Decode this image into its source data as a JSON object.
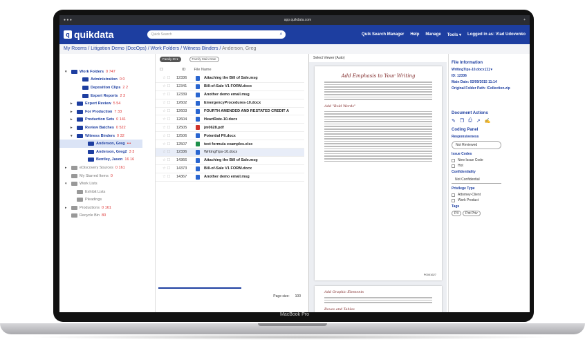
{
  "device": {
    "label": "MacBook Pro"
  },
  "browser": {
    "url": "app.quikdata.com"
  },
  "app": {
    "logo": "quikdata",
    "search_placeholder": "Quick Search",
    "nav": [
      "Quik Search Manager",
      "Help",
      "Manage",
      "Tools ▾",
      "Logged in as: Vlad Udovenko"
    ]
  },
  "breadcrumb": {
    "links": "My Rooms / Litigation Demo (DocOps) / Work Folders / Witness Binders /",
    "current": " Anderson, Greg"
  },
  "tree": [
    {
      "label": "Work Folders",
      "count": "0  747",
      "indent": 0,
      "caret": "▾"
    },
    {
      "label": "Administration",
      "count": "0  0",
      "indent": 2,
      "caret": ""
    },
    {
      "label": "Deposition Clips",
      "count": "2  2",
      "indent": 2,
      "caret": ""
    },
    {
      "label": "Expert Reports",
      "count": "2  3",
      "indent": 2,
      "caret": ""
    },
    {
      "label": "Expert Review",
      "count": "5  54",
      "indent": 1,
      "caret": "▸"
    },
    {
      "label": "For Production",
      "count": "7  33",
      "indent": 1,
      "caret": "▸"
    },
    {
      "label": "Production Sets",
      "count": "0  141",
      "indent": 1,
      "caret": "▸"
    },
    {
      "label": "Review Batches",
      "count": "0  522",
      "indent": 1,
      "caret": "▸"
    },
    {
      "label": "Witness Binders",
      "count": "0  32",
      "indent": 1,
      "caret": "▾"
    },
    {
      "label": "Anderson, Greg",
      "count": "•••",
      "indent": 3,
      "caret": "",
      "selected": true
    },
    {
      "label": "Anderson, Greg2",
      "count": "3  3",
      "indent": 3,
      "caret": ""
    },
    {
      "label": "Bentley, Jason",
      "count": "16  16",
      "indent": 3,
      "caret": ""
    },
    {
      "label": "eDiscovery Sources",
      "count": "0  161",
      "indent": 0,
      "caret": "▸",
      "gray": true
    },
    {
      "label": "My Starred Items",
      "count": "0",
      "indent": 0,
      "caret": "",
      "gray": true
    },
    {
      "label": "Work Lists",
      "count": "",
      "indent": 0,
      "caret": "▾",
      "gray": true
    },
    {
      "label": "Exhibit Lists",
      "count": "",
      "indent": 1,
      "caret": "",
      "gray": true
    },
    {
      "label": "Pleadings",
      "count": "",
      "indent": 1,
      "caret": "",
      "gray": true
    },
    {
      "label": "Productions",
      "count": "0  161",
      "indent": 0,
      "caret": "▸",
      "gray": true
    },
    {
      "label": "Recycle Bin",
      "count": "80",
      "indent": 0,
      "caret": "",
      "gray": true
    }
  ],
  "docs": {
    "filters": [
      "Family ID ▾",
      "Family Main Date"
    ],
    "col_id": "ID",
    "col_name": "File Name",
    "rows": [
      {
        "id": "12336",
        "name": "Attaching the Bill of Sale.msg",
        "type": "doc"
      },
      {
        "id": "12341",
        "name": "Bill-of-Sale V1 FORM.docx",
        "type": "doc"
      },
      {
        "id": "12339",
        "name": "Another demo email.msg",
        "type": "doc"
      },
      {
        "id": "12602",
        "name": "EmergencyProcedures-10.docx",
        "type": "doc"
      },
      {
        "id": "12603",
        "name": "FOURTH AMENDED AND RESTATED CREDIT A",
        "type": "doc"
      },
      {
        "id": "12604",
        "name": "HeartRate-10.docx",
        "type": "doc"
      },
      {
        "id": "12505",
        "name": "jm0628.pdf",
        "type": "pdf"
      },
      {
        "id": "12506",
        "name": "Potential PII.docx",
        "type": "doc"
      },
      {
        "id": "12507",
        "name": "text formula examples.xlsx",
        "type": "xls"
      },
      {
        "id": "12336",
        "name": "WritingTips-10.docx",
        "type": "doc",
        "current": true
      },
      {
        "id": "14366",
        "name": "Attaching the Bill of Sale.msg",
        "type": "doc"
      },
      {
        "id": "14373",
        "name": "Bill-of-Sale V1 FORM.docx",
        "type": "doc"
      },
      {
        "id": "14367",
        "name": "Another demo email.msg",
        "type": "doc"
      }
    ],
    "page_size_label": "Page size:",
    "page_size": "100"
  },
  "viewer": {
    "mode": "Select Viewer (Auto)",
    "heading": "Add Emphasis to Your Writing",
    "subheading": "Add \"Bold Words\"",
    "bates": "P0001627",
    "page2_heading": "Add Graphic Elements",
    "page2_sub": "Boxes and Tables"
  },
  "panel": {
    "title": "File Information",
    "file": "WritingTips-10.docx [1]  ▾",
    "id_line": "ID: 12336",
    "date_line": "Main Date: 02/09/2015 11:14",
    "path_line": "Original Folder Path: \\Collection.zip",
    "actions": "Document Actions",
    "coding": "Coding Panel",
    "resp_label": "Responsiveness",
    "resp_value": "Not Reviewed",
    "issue_label": "Issue Codes",
    "issues": [
      "New Issue Code",
      "Hot"
    ],
    "conf_label": "Confidentiality",
    "conf_value": "Not Confidential",
    "priv_label": "Privilege Type",
    "privs": [
      "Attorney-Client",
      "Work Product"
    ],
    "tags_label": "Tags",
    "tags": [
      "PII",
      "Pot Priv"
    ]
  },
  "colors": {
    "brand": "#1d3ea0",
    "count": "#dd3333"
  }
}
